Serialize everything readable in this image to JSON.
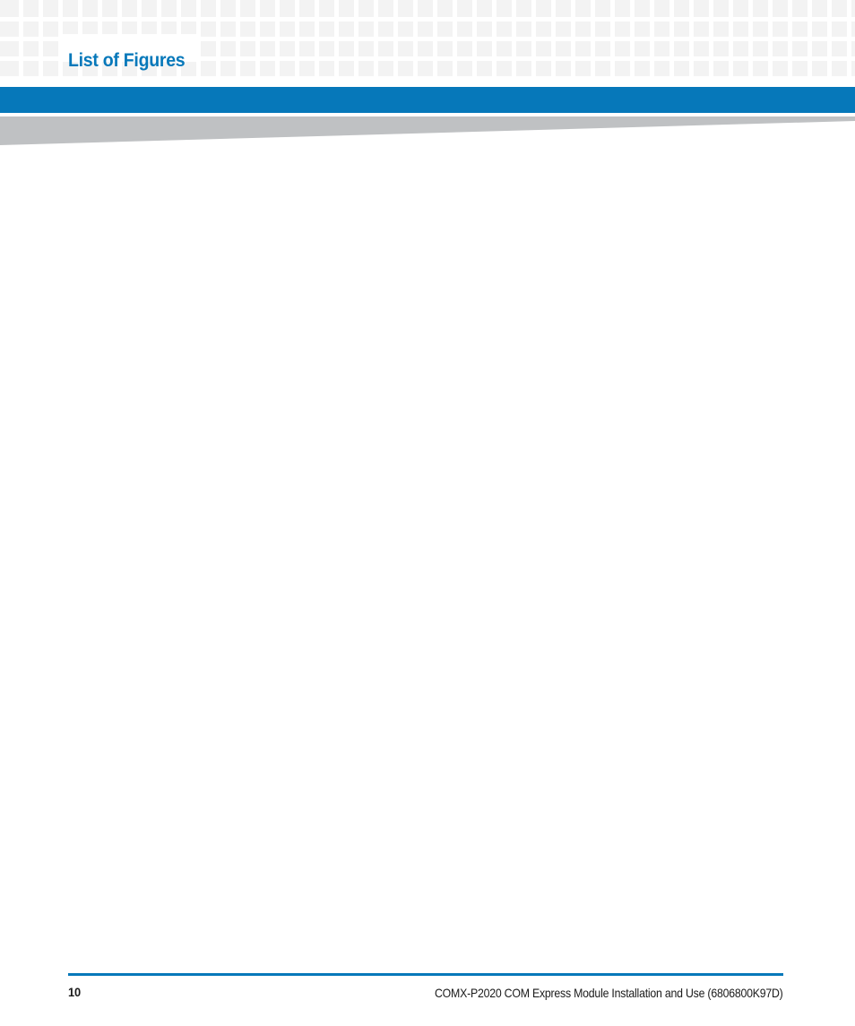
{
  "document": {
    "page_title": "List of Figures",
    "page_number": "10",
    "footer_doc_title": "COMX-P2020 COM Express Module Installation and Use (6806800K97D)"
  },
  "header": {
    "title": "List of Figures",
    "pattern_name": "square-grid-pattern",
    "pattern_rows": 4,
    "pattern_square_color": "#f3f3f3"
  },
  "banner": {
    "bar_color": "#0678ba",
    "wedge_color": "#bfc1c3"
  },
  "body": {
    "content": ""
  },
  "footer": {
    "rule_color": "#0678ba",
    "page_number": "10",
    "doc_title": "COMX-P2020 COM Express Module Installation and Use (6806800K97D)"
  },
  "colors": {
    "accent_blue": "#0678ba",
    "pattern_gray": "#f3f3f3",
    "wedge_gray": "#bfc1c3",
    "text_black": "#1a1a1a",
    "page_white": "#ffffff"
  }
}
